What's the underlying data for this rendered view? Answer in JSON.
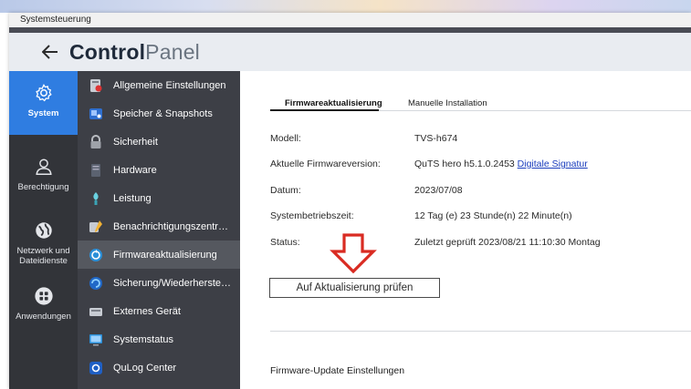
{
  "window": {
    "title": "Systemsteuerung"
  },
  "header": {
    "app_name_bold": "Control",
    "app_name_light": "Panel"
  },
  "rail": [
    {
      "label": "System",
      "icon": "gear-icon",
      "active": true
    },
    {
      "label": "Berechtigung",
      "icon": "user-icon",
      "active": false
    },
    {
      "label": "Netzwerk und Dateidienste",
      "icon": "globe-icon",
      "active": false
    },
    {
      "label": "Anwendungen",
      "icon": "apps-grid-icon",
      "active": false
    }
  ],
  "menu": [
    {
      "label": "Allgemeine Einstellungen",
      "icon": "general-settings-icon",
      "active": false
    },
    {
      "label": "Speicher & Snapshots",
      "icon": "storage-icon",
      "active": false
    },
    {
      "label": "Sicherheit",
      "icon": "lock-icon",
      "active": false
    },
    {
      "label": "Hardware",
      "icon": "hardware-icon",
      "active": false
    },
    {
      "label": "Leistung",
      "icon": "performance-icon",
      "active": false
    },
    {
      "label": "Benachrichtigungszentrum",
      "icon": "notification-icon",
      "active": false
    },
    {
      "label": "Firmwareaktualisierung",
      "icon": "firmware-icon",
      "active": true
    },
    {
      "label": "Sicherung/Wiederherstell...",
      "icon": "backup-icon",
      "active": false
    },
    {
      "label": "Externes Gerät",
      "icon": "external-device-icon",
      "active": false
    },
    {
      "label": "Systemstatus",
      "icon": "monitor-icon",
      "active": false
    },
    {
      "label": "QuLog Center",
      "icon": "qulog-icon",
      "active": false
    }
  ],
  "tabs": [
    {
      "label": "Firmwareaktualisierung",
      "active": true
    },
    {
      "label": "Manuelle Installation",
      "active": false
    }
  ],
  "details": {
    "model_label": "Modell:",
    "model_value": "TVS-h674",
    "firmware_label": "Aktuelle Firmwareversion:",
    "firmware_value": "QuTS hero h5.1.0.2453",
    "firmware_link": "Digitale Signatur",
    "date_label": "Datum:",
    "date_value": "2023/07/08",
    "uptime_label": "Systembetriebszeit:",
    "uptime_value": "12 Tag (e) 23 Stunde(n) 22 Minute(n)",
    "status_label": "Status:",
    "status_value": "Zuletzt geprüft 2023/08/21 11:10:30 Montag"
  },
  "check_button_label": "Auf Aktualisierung prüfen",
  "section_title": "Firmware-Update Einstellungen",
  "colors": {
    "accent": "#2f7de1",
    "rail_bg": "#323439",
    "menu_bg": "#3d3f46",
    "menu_active": "#55585f",
    "arrow_red": "#d92b22",
    "link": "#1a3dbd"
  }
}
